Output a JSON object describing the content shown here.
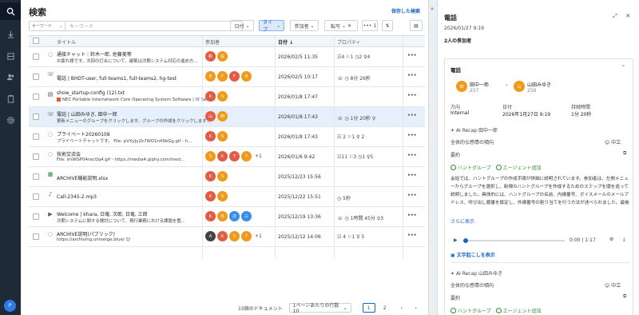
{
  "page_title": "検索",
  "saved_search": "保存した検索",
  "search": {
    "key_label": "キーワード",
    "placeholder": "キーワード"
  },
  "filters": {
    "date": "日付",
    "type": "タイプ",
    "participants": "参加者",
    "transcript": "転写",
    "count": "1"
  },
  "columns": {
    "title": "タイトル",
    "participants": "参加者",
    "date": "日付",
    "property": "プロパティ"
  },
  "rows": [
    {
      "icon": "chat",
      "t1": "通接チャット｜鈴木一郎, 佐藤美等",
      "t2": "お疲れ様です。次回の打合について、建築は次期システム対応の進め方...",
      "avatars": [
        {
          "c": "red",
          "l": "鈴"
        },
        {
          "c": "ora",
          "l": "佐"
        }
      ],
      "extra": "",
      "date": "2026/02/5 11:35",
      "prop": "☷4 ⚐1 ◷2 ♀4"
    },
    {
      "icon": "call",
      "t1": "電話 | BHDT-user, full-teams1, full-teams2, hg-test",
      "t2": "",
      "avatars": [
        {
          "c": "ora",
          "l": "B"
        },
        {
          "c": "ora",
          "l": "F"
        },
        {
          "c": "red",
          "l": "F"
        },
        {
          "c": "ora",
          "l": "H"
        }
      ],
      "extra": "",
      "date": "2026/02/5 10:17",
      "prop": "☏ ◷ 8分 26秒"
    },
    {
      "icon": "file",
      "t1": "show_startup-config (12).txt",
      "t2": "NEC Portable Internetwork Core Operating System Software | IX Serie...",
      "mark": true,
      "avatars": [
        {
          "c": "red",
          "l": "K"
        },
        {
          "c": "ora",
          "l": "S"
        }
      ],
      "extra": "",
      "date": "2026/01/8 17:47",
      "prop": ""
    },
    {
      "icon": "call",
      "t1": "電話 | 山田みゆき, 田中一郎",
      "t2": "更新メニューのグループをクリックします。グループの作成をクリックします...",
      "avatars": [
        {
          "c": "red",
          "l": "山"
        },
        {
          "c": "ora",
          "l": "田"
        }
      ],
      "extra": "",
      "date": "2026/01/8 17:43",
      "prop": "☏ ◷ 1分 20秒 ♀"
    },
    {
      "icon": "chat",
      "t1": "プライベート20260108",
      "t2": "プライベートチャットです。 File: pVXyJy2k7WO1n49bGg.gif - h...",
      "avatars": [
        {
          "c": "red",
          "l": "K"
        },
        {
          "c": "ora",
          "l": "S"
        }
      ],
      "extra": "",
      "date": "2026/01/8 17:43",
      "prop": "☷ 2 ⚐1 ♀ 2"
    },
    {
      "icon": "chat",
      "t1": "技術交流会",
      "t2": "File: imWGP04racQq4.gif - https://media4.giphy.com/med...",
      "avatars": [
        {
          "c": "ora",
          "l": "S"
        },
        {
          "c": "red",
          "l": "K"
        },
        {
          "c": "red",
          "l": "T"
        },
        {
          "c": "ora",
          "l": "Y"
        }
      ],
      "extra": "+1",
      "date": "2026/01/6 9:42",
      "prop": "☷11 ⚐3 ◷1 ♀5"
    },
    {
      "icon": "xls",
      "t1": "ARCHIVE機能説明.xlsx",
      "t2": "",
      "avatars": [
        {
          "c": "red",
          "l": "K"
        },
        {
          "c": "ora",
          "l": "S"
        }
      ],
      "extra": "",
      "date": "2025/12/23 15:56",
      "prop": ""
    },
    {
      "icon": "mic",
      "t1": "Call-2345-2.mp3",
      "t2": "",
      "avatars": [
        {
          "c": "red",
          "l": "K"
        },
        {
          "c": "ora",
          "l": "S"
        }
      ],
      "extra": "",
      "date": "2025/12/22 15:51",
      "prop": "◷ 5秒"
    },
    {
      "icon": "video",
      "t1": "Welcome | khara, 日竜, 次郎, 日竜, 三郎",
      "t2": "次期システムに関する検討について、現行業務における課題を整...",
      "avatars": [
        {
          "c": "red",
          "l": "K"
        },
        {
          "c": "ora",
          "l": "日"
        },
        {
          "c": "blu",
          "l": "次"
        },
        {
          "c": "blu",
          "l": "三"
        }
      ],
      "extra": "",
      "date": "2025/12/19 13:36",
      "prop": "☏ ◷ 1時間 45分 ♀3"
    },
    {
      "icon": "chat",
      "t1": "ARCHIVE説明(パブリック)",
      "t2": "https://archiving.univerge.blue/ 😊",
      "avatars": [
        {
          "c": "dk",
          "l": "A"
        },
        {
          "c": "red",
          "l": "K"
        },
        {
          "c": "ora",
          "l": "S"
        },
        {
          "c": "ora",
          "l": "T"
        }
      ],
      "extra": "+1",
      "date": "2025/12/12 14:06",
      "prop": "☷ 4 ⚐1 ♀ 5"
    }
  ],
  "footer": {
    "docs": "15個のドキュメント",
    "per_page": "1ページあたりの行数  10",
    "page1": "1",
    "page2": "2"
  },
  "panel": {
    "title": "電話",
    "date": "2026/01/27 9:19",
    "participants": "2人の参加者",
    "card_title": "電話",
    "caller": {
      "name": "田中一郎",
      "ext": "257",
      "initial": "田"
    },
    "callee": {
      "name": "山田みゆき",
      "ext": "256",
      "initial": "山"
    },
    "labels": {
      "direction": "方向",
      "date": "日付",
      "duration": "持続時間"
    },
    "values": {
      "direction": "Internal",
      "date": "2026年1月27日 9:19",
      "duration": "1分 20秒"
    },
    "recap": "AI Recap 田中一郎",
    "sentiment_label": "全体的な感情の傾向",
    "sentiment_value": "中立",
    "summary_label": "要約",
    "tag1": "ハントグループ",
    "tag2": "エージェント追加",
    "summary": "会話では、ハントグループの作成手順が詳細に説明されています。参加者は、左側メニューからグループを選択し、新規のハントグループを作成するためのステップを順を追って説明しました。具体的には、ハントグループの名前、内線番号、ボイスメールのメールアドレス、呼び出し順番を設定し、外線番号の割り当てを行う方法が述べられました。最後に、新しいエージェントを追加する手順も紹介され、指定が完了するまでの流れが説明されました。",
    "show_more": "さらに表示",
    "audio_time": "0:00 | 1:17",
    "transcript_link": "文字起こしを表示",
    "recap2": "AI Recap 山田みゆき",
    "sentiment_value2": "中立"
  }
}
